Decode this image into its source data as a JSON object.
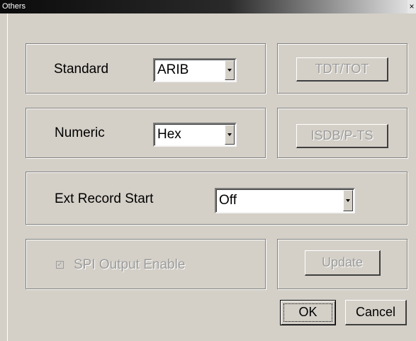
{
  "window": {
    "title": "Others",
    "close_glyph": "×"
  },
  "standard": {
    "label": "Standard",
    "value": "ARIB"
  },
  "tdt_button": {
    "label": "TDT/TOT"
  },
  "numeric": {
    "label": "Numeric",
    "value": "Hex"
  },
  "isdb_button": {
    "label": "ISDB/P-TS"
  },
  "ext_record": {
    "label": "Ext Record Start",
    "value": "Off"
  },
  "spi": {
    "label": "SPI Output Enable",
    "checked": true,
    "check_glyph": "✓"
  },
  "update_button": {
    "label": "Update"
  },
  "ok_button": {
    "label": "OK"
  },
  "cancel_button": {
    "label": "Cancel"
  },
  "colors": {
    "dialog_bg": "#d4d0c8",
    "disabled_text": "#9c9c9c"
  }
}
